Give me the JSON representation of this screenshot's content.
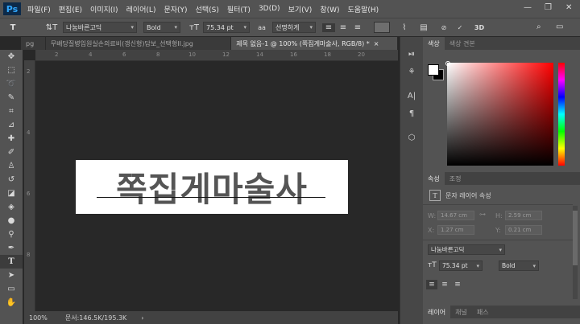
{
  "app": {
    "logo": "Ps"
  },
  "menu": [
    "파일(F)",
    "편집(E)",
    "이미지(I)",
    "레이어(L)",
    "문자(Y)",
    "선택(S)",
    "필터(T)",
    "3D(D)",
    "보기(V)",
    "창(W)",
    "도움말(H)"
  ],
  "options": {
    "font_family": "나눔바른고딕",
    "font_style": "Bold",
    "font_size": "75.34 pt",
    "aa_icon": "aa",
    "antialias": "선명하게",
    "mode_label": "3D"
  },
  "tabs": [
    {
      "label": "pg"
    },
    {
      "label": "무배당질병입원실손의료비(갱신형)담보_선택형II.jpg"
    },
    {
      "label": "제목 없음-1 @ 100% (쪽집게마술사, RGB/8) *",
      "close": "×"
    }
  ],
  "ruler": {
    "top": [
      "2",
      "4",
      "6",
      "8",
      "10",
      "12",
      "14",
      "16",
      "18",
      "20"
    ],
    "left": [
      "2",
      "4",
      "6",
      "8"
    ]
  },
  "canvas": {
    "text": "쪽집게마술사"
  },
  "status": {
    "zoom": "100%",
    "doc_size": "문서:146.5K/195.3K",
    "arrow": "›"
  },
  "color_panel": {
    "tabs": [
      "색상",
      "색상 견본"
    ]
  },
  "props_panel": {
    "tabs": [
      "속성",
      "조정"
    ],
    "title": "문자 레이어 속성",
    "w_label": "W:",
    "w_value": "14.67 cm",
    "h_label": "H:",
    "h_value": "2.59 cm",
    "x_label": "X:",
    "x_value": "1.27 cm",
    "y_label": "Y:",
    "y_value": "0.21 cm",
    "font_family": "나눔바른고딕",
    "font_size": "75.34 pt",
    "font_style": "Bold"
  },
  "bottom_tabs": [
    "레이어",
    "채널",
    "패스"
  ],
  "colors": {
    "chrome": "#535353",
    "canvas": "#282828",
    "accent": "#31a8ff"
  }
}
